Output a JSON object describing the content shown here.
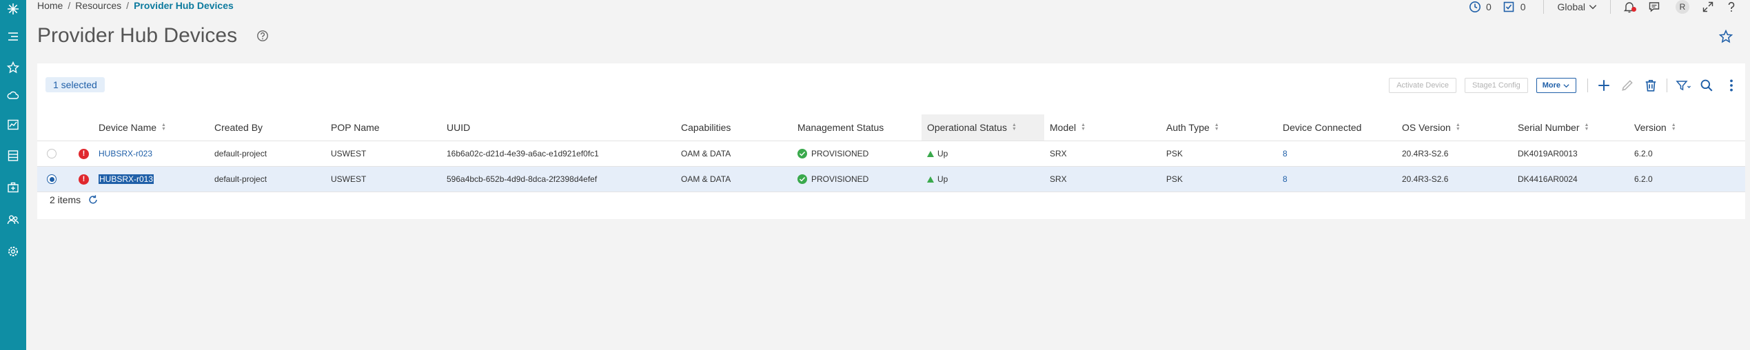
{
  "breadcrumb": {
    "home": "Home",
    "resources": "Resources",
    "current": "Provider Hub Devices"
  },
  "header": {
    "alerts_count": "0",
    "tasks_count": "0",
    "scope": "Global",
    "user_initial": "R"
  },
  "page": {
    "title": "Provider Hub Devices"
  },
  "toolbar": {
    "selected": "1 selected",
    "activate": "Activate Device",
    "stage1": "Stage1 Config",
    "more": "More"
  },
  "table": {
    "columns": [
      "Device Name",
      "Created By",
      "POP Name",
      "UUID",
      "Capabilities",
      "Management Status",
      "Operational Status",
      "Model",
      "Auth Type",
      "Device Connected",
      "OS Version",
      "Serial Number",
      "Version"
    ],
    "rows": [
      {
        "device_name": "HUBSRX-r023",
        "created_by": "default-project",
        "pop": "USWEST",
        "uuid": "16b6a02c-d21d-4e39-a6ac-e1d921ef0fc1",
        "capabilities": "OAM & DATA",
        "mgmt_status": "PROVISIONED",
        "op_status": "Up",
        "model": "SRX",
        "auth": "PSK",
        "connected": "8",
        "os": "20.4R3-S2.6",
        "serial": "DK4019AR0013",
        "version": "6.2.0"
      },
      {
        "device_name": "HUBSRX-r013",
        "created_by": "default-project",
        "pop": "USWEST",
        "uuid": "596a4bcb-652b-4d9d-8dca-2f2398d4efef",
        "capabilities": "OAM & DATA",
        "mgmt_status": "PROVISIONED",
        "op_status": "Up",
        "model": "SRX",
        "auth": "PSK",
        "connected": "8",
        "os": "20.4R3-S2.6",
        "serial": "DK4416AR0024",
        "version": "6.2.0"
      }
    ]
  },
  "footer": {
    "items": "2 items"
  },
  "colors": {
    "nav": "#0f8ea4",
    "link": "#1f5fa8",
    "error": "#e0282e",
    "ok": "#3aa94c"
  }
}
